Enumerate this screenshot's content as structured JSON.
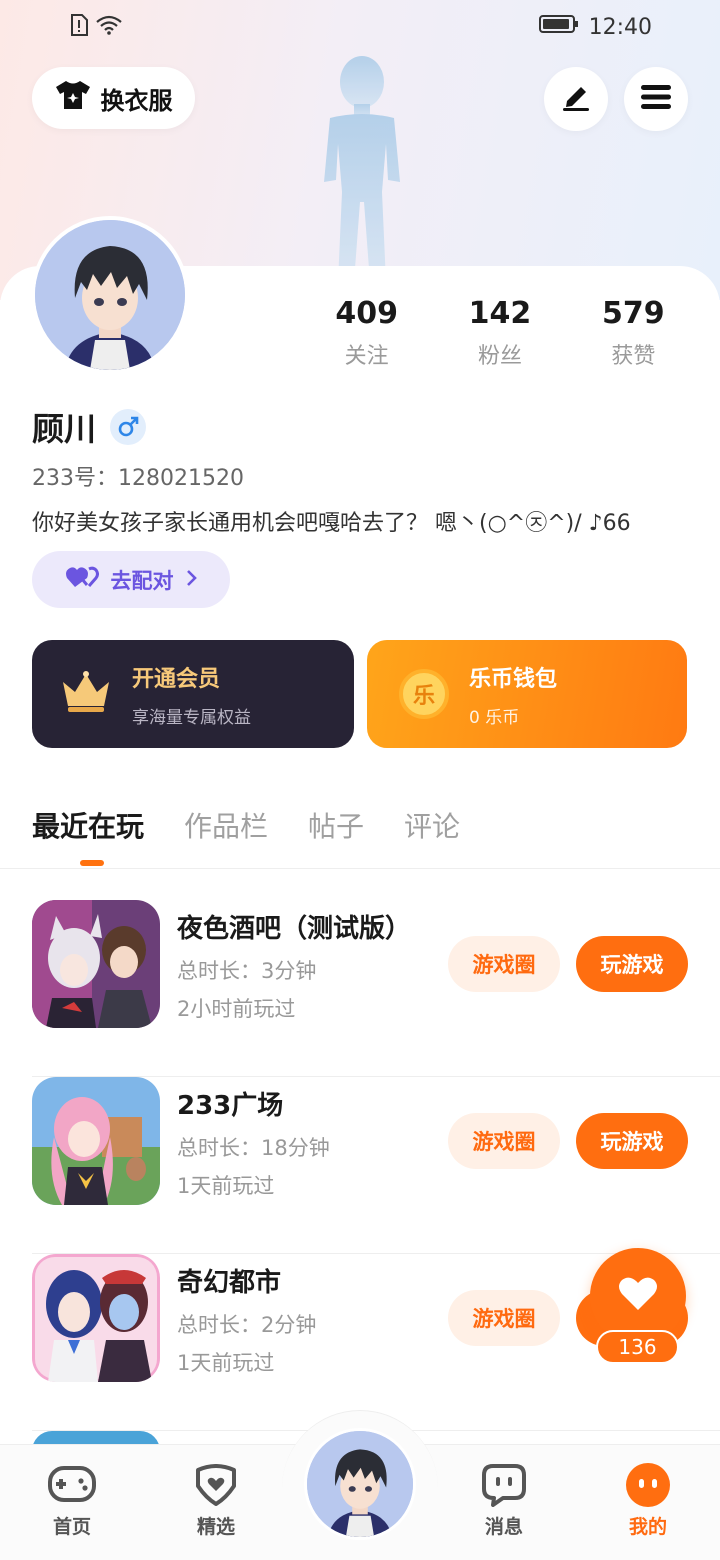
{
  "status_bar": {
    "time": "12:40"
  },
  "header": {
    "dress_label": "换衣服"
  },
  "profile": {
    "username": "顾川",
    "uid_line": "233号：128021520",
    "bio": "你好美女孩子家长通用机会吧嘎哈去了？ 嗯丶(○^㉨^)/ ♪66",
    "match_label": "去配对",
    "stats": [
      {
        "value": "409",
        "label": "关注"
      },
      {
        "value": "142",
        "label": "粉丝"
      },
      {
        "value": "579",
        "label": "获赞"
      }
    ]
  },
  "promo": {
    "vip": {
      "title": "开通会员",
      "subtitle": "享海量专属权益"
    },
    "wallet": {
      "title": "乐币钱包",
      "subtitle": "0 乐币",
      "coin_glyph": "乐"
    }
  },
  "tabs": [
    "最近在玩",
    "作品栏",
    "帖子",
    "评论"
  ],
  "games": [
    {
      "name": "夜色酒吧（测试版）",
      "duration": "总时长：3分钟",
      "last_played": "2小时前玩过",
      "circle_label": "游戏圈",
      "play_label": "玩游戏"
    },
    {
      "name": "233广场",
      "duration": "总时长：18分钟",
      "last_played": "1天前玩过",
      "circle_label": "游戏圈",
      "play_label": "玩游戏"
    },
    {
      "name": "奇幻都市",
      "duration": "总时长：2分钟",
      "last_played": "1天前玩过",
      "circle_label": "游戏圈",
      "play_label": "玩游戏"
    }
  ],
  "floating_like": {
    "count": "136"
  },
  "bottom_nav": [
    {
      "label": "首页",
      "icon": "gamepad-icon"
    },
    {
      "label": "精选",
      "icon": "heart-badge-icon"
    },
    {
      "label": "消息",
      "icon": "chat-icon"
    },
    {
      "label": "我的",
      "icon": "smile-icon"
    }
  ],
  "colors": {
    "accent": "#ff6e10",
    "vip_bg": "#272335",
    "match_text": "#6b55e0"
  }
}
